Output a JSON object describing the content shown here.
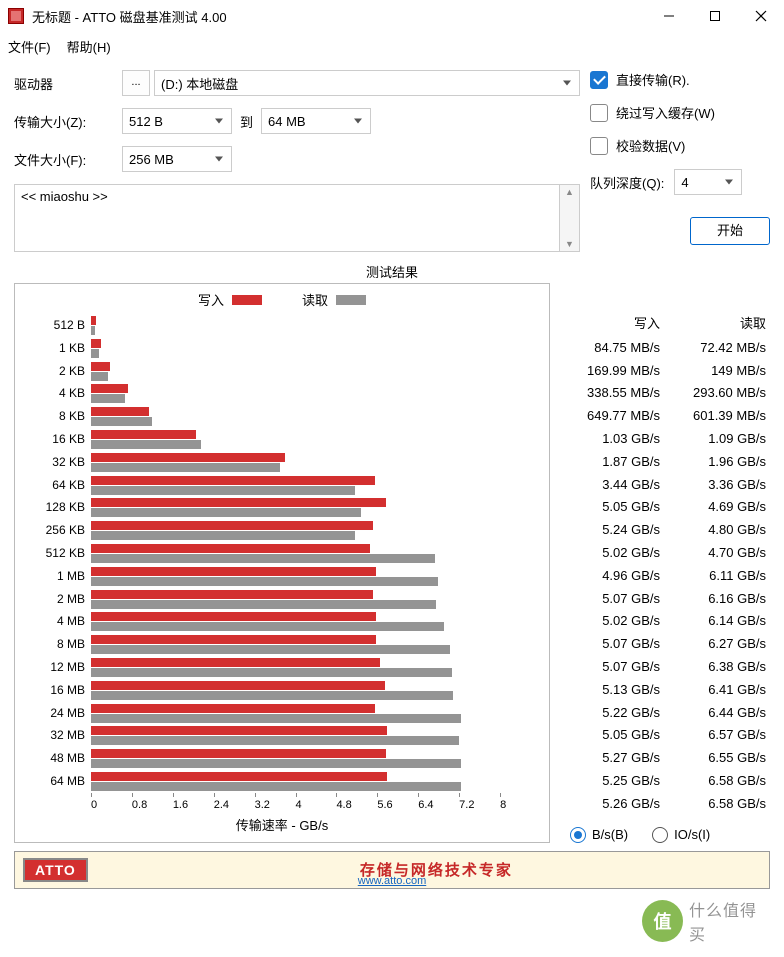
{
  "window": {
    "title": "无标题 - ATTO 磁盘基准测试 4.00"
  },
  "menu": {
    "file": "文件(F)",
    "help": "帮助(H)"
  },
  "labels": {
    "drive": "驱动器",
    "browse": "...",
    "transfer_size": "传输大小(Z):",
    "to": "到",
    "file_size": "文件大小(F):",
    "direct_io": "直接传输(R).",
    "bypass_cache": "绕过写入缓存(W)",
    "verify": "校验数据(V)",
    "queue_depth": "队列深度(Q):",
    "start": "开始",
    "results_title": "测试结果",
    "legend_write": "写入",
    "legend_read": "读取",
    "x_axis_label": "传输速率 - GB/s",
    "col_write": "写入",
    "col_read": "读取",
    "radio_bs": "B/s(B)",
    "radio_ios": "IO/s(I)",
    "footer_tag": "存储与网络技术专家",
    "footer_logo": "ATTO",
    "footer_url": "www.atto.com"
  },
  "values": {
    "drive": "(D:) 本地磁盘",
    "ts_from": "512 B",
    "ts_to": "64 MB",
    "file_size": "256 MB",
    "queue_depth": "4",
    "description": "<< miaoshu >>"
  },
  "checkboxes": {
    "direct_io": true,
    "bypass_cache": false,
    "verify": false
  },
  "radio": {
    "mode": "bs"
  },
  "x_ticks": [
    "0",
    "0.8",
    "1.6",
    "2.4",
    "3.2",
    "4",
    "4.8",
    "5.6",
    "6.4",
    "7.2",
    "8"
  ],
  "chart_data": {
    "type": "bar",
    "title": "测试结果",
    "xlabel": "传输速率 - GB/s",
    "ylabel": "",
    "xlim": [
      0,
      8
    ],
    "categories": [
      "512 B",
      "1 KB",
      "2 KB",
      "4 KB",
      "8 KB",
      "16 KB",
      "32 KB",
      "64 KB",
      "128 KB",
      "256 KB",
      "512 KB",
      "1 MB",
      "2 MB",
      "4 MB",
      "8 MB",
      "12 MB",
      "16 MB",
      "24 MB",
      "32 MB",
      "48 MB",
      "64 MB"
    ],
    "series": [
      {
        "name": "写入",
        "unit": "GB/s",
        "values_display": [
          "84.75 MB/s",
          "169.99 MB/s",
          "338.55 MB/s",
          "649.77 MB/s",
          "1.03 GB/s",
          "1.87 GB/s",
          "3.44 GB/s",
          "5.05 GB/s",
          "5.24 GB/s",
          "5.02 GB/s",
          "4.96 GB/s",
          "5.07 GB/s",
          "5.02 GB/s",
          "5.07 GB/s",
          "5.07 GB/s",
          "5.13 GB/s",
          "5.22 GB/s",
          "5.05 GB/s",
          "5.27 GB/s",
          "5.25 GB/s",
          "5.26 GB/s"
        ],
        "values": [
          0.08475,
          0.16999,
          0.33855,
          0.64977,
          1.03,
          1.87,
          3.44,
          5.05,
          5.24,
          5.02,
          4.96,
          5.07,
          5.02,
          5.07,
          5.07,
          5.13,
          5.22,
          5.05,
          5.27,
          5.25,
          5.26
        ]
      },
      {
        "name": "读取",
        "unit": "GB/s",
        "values_display": [
          "72.42 MB/s",
          "149 MB/s",
          "293.60 MB/s",
          "601.39 MB/s",
          "1.09 GB/s",
          "1.96 GB/s",
          "3.36 GB/s",
          "4.69 GB/s",
          "4.80 GB/s",
          "4.70 GB/s",
          "6.11 GB/s",
          "6.16 GB/s",
          "6.14 GB/s",
          "6.27 GB/s",
          "6.38 GB/s",
          "6.41 GB/s",
          "6.44 GB/s",
          "6.57 GB/s",
          "6.55 GB/s",
          "6.58 GB/s",
          "6.58 GB/s"
        ],
        "values": [
          0.07242,
          0.149,
          0.2936,
          0.60139,
          1.09,
          1.96,
          3.36,
          4.69,
          4.8,
          4.7,
          6.11,
          6.16,
          6.14,
          6.27,
          6.38,
          6.41,
          6.44,
          6.57,
          6.55,
          6.58,
          6.58
        ]
      }
    ]
  },
  "watermark": {
    "badge": "值",
    "text": "什么值得买"
  }
}
